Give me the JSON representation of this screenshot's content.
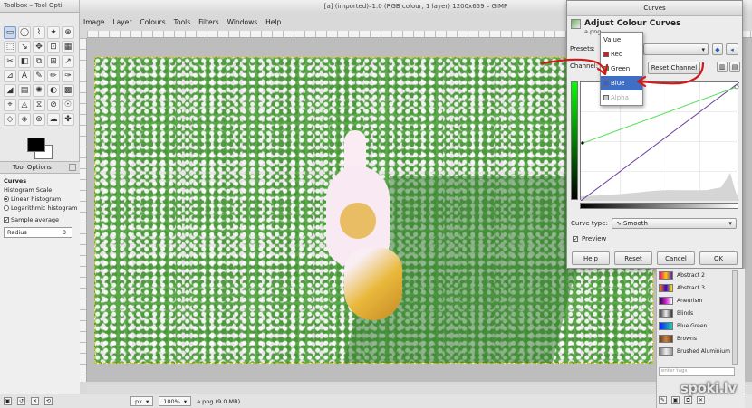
{
  "toolbox": {
    "title": "Toolbox – Tool Opti",
    "tools": [
      "▭",
      "◯",
      "⌇",
      "✦",
      "⊕",
      "⬚",
      "↘",
      "✥",
      "⊡",
      "▦",
      "✂",
      "◧",
      "⧉",
      "⊞",
      "↗",
      "⊿",
      "A",
      "✎",
      "✏",
      "✑",
      "◢",
      "▤",
      "✺",
      "◐",
      "▩",
      "⌖",
      "◬",
      "⧖",
      "⊘",
      "☉",
      "◇",
      "◈",
      "⊚",
      "☁",
      "✤"
    ],
    "colors": {
      "fg": "#000000",
      "bg": "#ffffff"
    },
    "options": {
      "tab": "Tool Options",
      "tool_name": "Curves",
      "histogram_scale": "Histogram Scale",
      "linear": "Linear histogram",
      "logarithmic": "Logarithmic histogram",
      "sample_average": "Sample average",
      "radius_label": "Radius",
      "radius_value": "3"
    }
  },
  "main": {
    "title": "[a] (imported)–1.0 (RGB colour, 1 layer) 1200x659 – GIMP",
    "menu": [
      "Image",
      "Layer",
      "Colours",
      "Tools",
      "Filters",
      "Windows",
      "Help"
    ],
    "status": {
      "unit": "px",
      "zoom": "100%",
      "file": "a.png (9.0 MB)"
    }
  },
  "curves": {
    "window_title": "Curves",
    "heading": "Adjust Colour Curves",
    "subtitle": "a.png-",
    "presets_label": "Presets:",
    "channel_label": "Channel:",
    "reset_channel": "Reset Channel",
    "curve_type_label": "Curve type:",
    "curve_type_value": "Smooth",
    "preview_label": "Preview",
    "buttons": {
      "help": "Help",
      "reset": "Reset",
      "cancel": "Cancel",
      "ok": "OK"
    },
    "channel_menu": [
      {
        "label": "Value",
        "color": "#ffffff",
        "state": "normal"
      },
      {
        "label": "Red",
        "color": "#d02020",
        "state": "normal"
      },
      {
        "label": "Green",
        "color": "#3fae2f",
        "state": "normal"
      },
      {
        "label": "Blue",
        "color": "#3060e0",
        "state": "highlighted"
      },
      {
        "label": "Alpha",
        "color": "#cccccc",
        "state": "disabled"
      }
    ]
  },
  "dock": {
    "gradients": [
      {
        "name": "Abstract 2",
        "colors": [
          "#e5007a",
          "#ffcc00",
          "#5522aa"
        ]
      },
      {
        "name": "Abstract 3",
        "colors": [
          "#ff8800",
          "#3300cc",
          "#ffee00"
        ]
      },
      {
        "name": "Aneurism",
        "colors": [
          "#220044",
          "#cc22cc",
          "#ffffff"
        ]
      },
      {
        "name": "Blinds",
        "colors": [
          "#333333",
          "#eeeeee",
          "#333333"
        ]
      },
      {
        "name": "Blue Green",
        "colors": [
          "#0022ff",
          "#22ccaa"
        ]
      },
      {
        "name": "Browns",
        "colors": [
          "#5c3a1a",
          "#c68642",
          "#6b3e1e"
        ]
      },
      {
        "name": "Brushed Aluminium",
        "colors": [
          "#777777",
          "#eeeeee",
          "#999999"
        ]
      }
    ],
    "tag_placeholder": "enter tags"
  },
  "watermark": "spoki.lv"
}
